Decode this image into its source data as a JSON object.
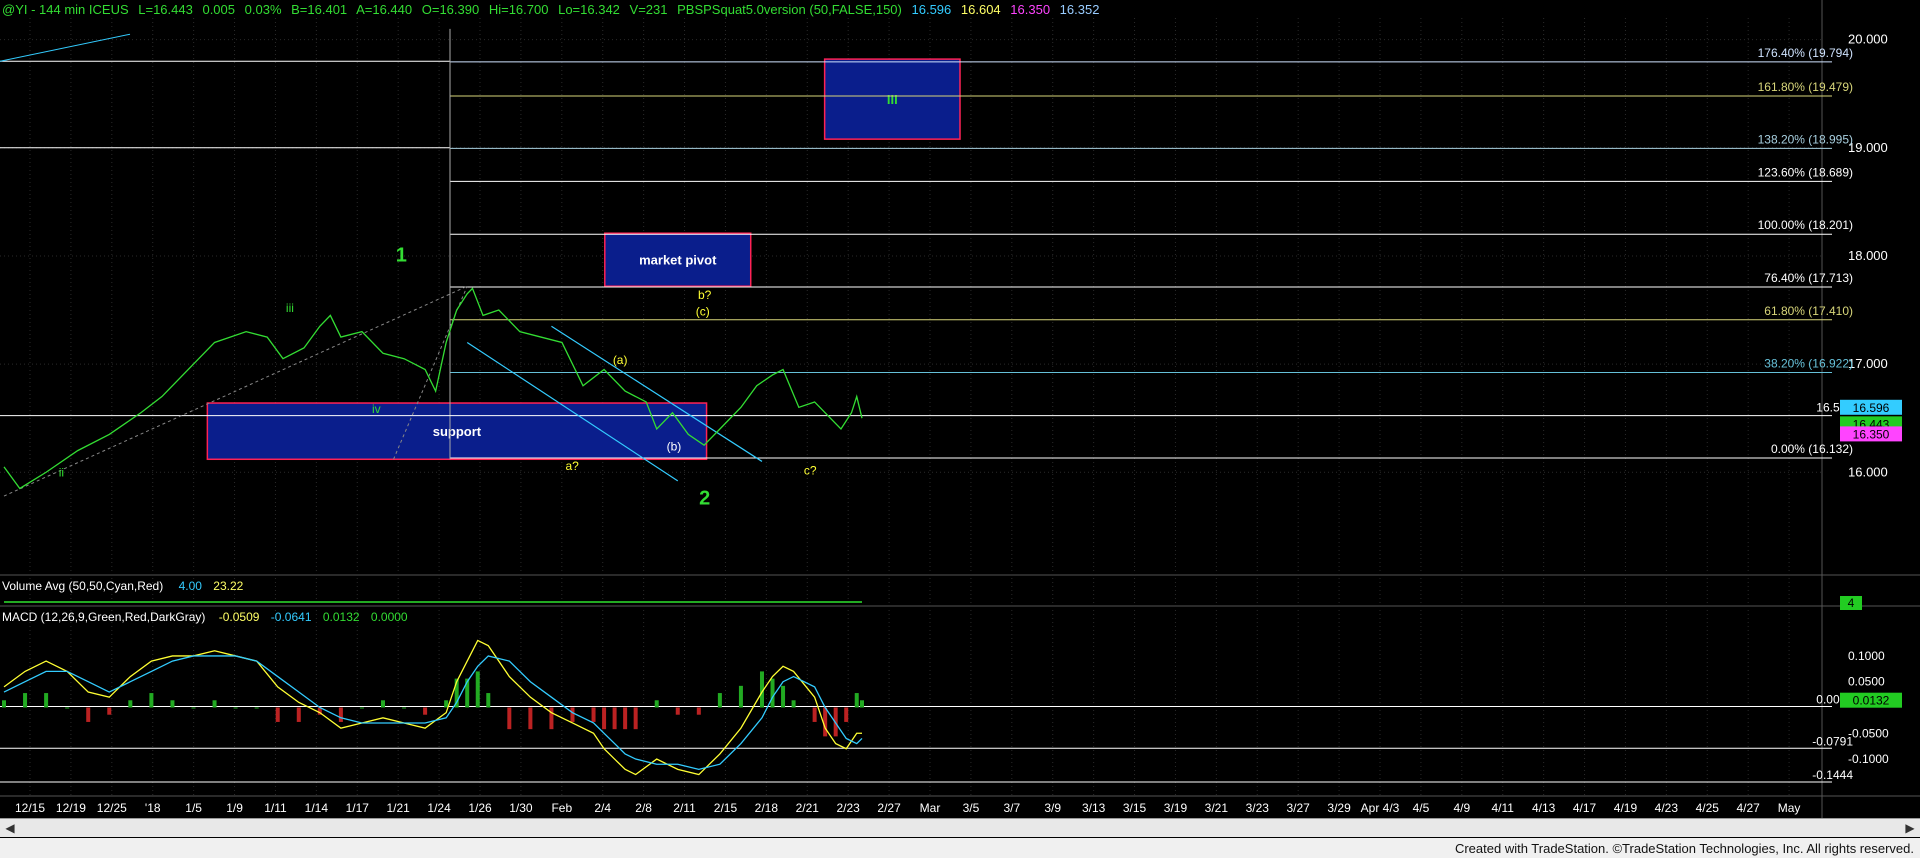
{
  "header": {
    "symbol": "@YI - 144 min  ICEUS",
    "last": "L=16.443",
    "chg": "0.005",
    "pct": "0.03%",
    "bid": "B=16.401",
    "ask": "A=16.440",
    "open": "O=16.390",
    "hi": "Hi=16.700",
    "lo": "Lo=16.342",
    "vol": "V=231",
    "study": "PBSPSquat5.0version (50,FALSE,150)",
    "study_vals": [
      "16.596",
      "16.604",
      "16.350",
      "16.352"
    ],
    "study_colors": [
      "#33ccff",
      "#ffff66",
      "#ff44ff",
      "#99ccff"
    ]
  },
  "volume_header": {
    "label": "Volume Avg (50,50,Cyan,Red)",
    "v1": "4.00",
    "v2": "23.22"
  },
  "macd_header": {
    "label": "MACD (12,26,9,Green,Red,DarkGray)",
    "v1": "-0.0509",
    "v2": "-0.0641",
    "v3": "0.0132",
    "v4": "0.0000"
  },
  "footer": "Created with TradeStation. ©TradeStation Technologies, Inc. All rights reserved.",
  "chart_data": {
    "type": "line",
    "price_axis": {
      "ticks": [
        "20.000",
        "19.000",
        "18.000",
        "17.000",
        "16.000"
      ],
      "ylim": [
        15.05,
        20.2
      ]
    },
    "x_tick_labels": [
      "12/15",
      "12/19",
      "12/25",
      "'18",
      "1/5",
      "1/9",
      "1/11",
      "1/14",
      "1/17",
      "1/21",
      "1/24",
      "1/26",
      "1/30",
      "Feb",
      "2/4",
      "2/8",
      "2/11",
      "2/15",
      "2/18",
      "2/21",
      "2/23",
      "2/27",
      "Mar",
      "3/5",
      "3/7",
      "3/9",
      "3/13",
      "3/15",
      "3/19",
      "3/21",
      "3/23",
      "3/27",
      "3/29",
      "Apr 4/3",
      "4/5",
      "4/9",
      "4/11",
      "4/13",
      "4/17",
      "4/19",
      "4/23",
      "4/25",
      "4/27",
      "May"
    ],
    "price_series": [
      [
        0,
        16.05
      ],
      [
        3,
        15.85
      ],
      [
        8,
        16.0
      ],
      [
        14,
        16.2
      ],
      [
        20,
        16.35
      ],
      [
        26,
        16.55
      ],
      [
        30,
        16.7
      ],
      [
        36,
        17.0
      ],
      [
        40,
        17.2
      ],
      [
        46,
        17.3
      ],
      [
        50,
        17.25
      ],
      [
        53,
        17.05
      ],
      [
        57,
        17.15
      ],
      [
        60,
        17.35
      ],
      [
        62,
        17.45
      ],
      [
        64,
        17.25
      ],
      [
        68,
        17.3
      ],
      [
        72,
        17.1
      ],
      [
        76,
        17.05
      ],
      [
        78,
        17.0
      ],
      [
        80,
        16.95
      ],
      [
        82,
        16.75
      ],
      [
        84,
        17.2
      ],
      [
        86,
        17.5
      ],
      [
        88,
        17.65
      ],
      [
        89,
        17.7
      ],
      [
        91,
        17.45
      ],
      [
        94,
        17.5
      ],
      [
        98,
        17.3
      ],
      [
        102,
        17.25
      ],
      [
        106,
        17.2
      ],
      [
        110,
        16.8
      ],
      [
        114,
        16.95
      ],
      [
        118,
        16.75
      ],
      [
        122,
        16.65
      ],
      [
        124,
        16.4
      ],
      [
        127,
        16.55
      ],
      [
        130,
        16.35
      ],
      [
        133,
        16.25
      ],
      [
        136,
        16.4
      ],
      [
        140,
        16.6
      ],
      [
        143,
        16.8
      ],
      [
        146,
        16.9
      ],
      [
        148,
        16.95
      ],
      [
        151,
        16.6
      ],
      [
        154,
        16.65
      ],
      [
        157,
        16.5
      ],
      [
        159,
        16.4
      ],
      [
        161,
        16.55
      ],
      [
        162,
        16.7
      ],
      [
        163,
        16.5
      ]
    ],
    "fib_levels": [
      {
        "pct": "176.40% (19.794)",
        "price": 19.794,
        "color": "#cfe3ff",
        "extra": "19.715"
      },
      {
        "pct": "161.80% (19.479)",
        "price": 19.479,
        "color": "#d8d67a"
      },
      {
        "pct": "138.20% (18.995)",
        "price": 18.995,
        "color": "#a8d0e0",
        "extra": "18.995"
      },
      {
        "pct": "123.60% (18.689)",
        "price": 18.689,
        "color": "#ffffff"
      },
      {
        "pct": "100.00% (18.201)",
        "price": 18.201,
        "color": "#ffffff"
      },
      {
        "pct": "76.40% (17.713)",
        "price": 17.713,
        "color": "#ffffff"
      },
      {
        "pct": "61.80% (17.410)",
        "price": 17.41,
        "color": "#d8d67a"
      },
      {
        "pct": "38.20% (16.922)",
        "price": 16.922,
        "color": "#66c0d8"
      },
      {
        "pct": "0.00% (16.132)",
        "price": 16.132,
        "color": "#ffffff"
      }
    ],
    "price_tags": [
      {
        "text": "16.596",
        "price": 16.596,
        "bg": "#33ccff",
        "fg": "#000"
      },
      {
        "text": "16.443",
        "price": 16.443,
        "bg": "#22cc22",
        "fg": "#000"
      },
      {
        "text": "16.350",
        "price": 16.35,
        "bg": "#ff44ff",
        "fg": "#000"
      }
    ],
    "level_16524": {
      "text": "16.524",
      "price": 16.524
    },
    "boxes": [
      {
        "label": "III",
        "label_color": "#33dd33",
        "bold": true,
        "p_top": 19.82,
        "p_bot": 19.08,
        "x0": 0.4295,
        "x1": 0.5
      },
      {
        "label": "market pivot",
        "label_color": "#ffffff",
        "bold": true,
        "p_top": 18.21,
        "p_bot": 17.72,
        "x0": 0.315,
        "x1": 0.391
      },
      {
        "label": "support",
        "label_color": "#ffffff",
        "bold": true,
        "p_top": 16.64,
        "p_bot": 16.12,
        "x0": 0.108,
        "x1": 0.368
      }
    ],
    "wave_labels": [
      {
        "text": "1",
        "color": "#33dd33",
        "big": true,
        "x": 0.209,
        "price": 17.95
      },
      {
        "text": "iii",
        "color": "#33dd33",
        "x": 0.151,
        "price": 17.48
      },
      {
        "text": "iv",
        "color": "#33dd33",
        "x": 0.196,
        "price": 16.55
      },
      {
        "text": "ii",
        "color": "#33dd33",
        "x": 0.032,
        "price": 15.96
      },
      {
        "text": "2",
        "color": "#33dd33",
        "big": true,
        "x": 0.367,
        "price": 15.7
      },
      {
        "text": "b?",
        "color": "#ffff33",
        "x": 0.367,
        "price": 17.6
      },
      {
        "text": "(c)",
        "color": "#ffff33",
        "x": 0.366,
        "price": 17.45
      },
      {
        "text": "(a)",
        "color": "#ffff33",
        "x": 0.323,
        "price": 17.0
      },
      {
        "text": "(b)",
        "color": "#ffffff",
        "x": 0.351,
        "price": 16.2
      },
      {
        "text": "a?",
        "color": "#ffff33",
        "x": 0.298,
        "price": 16.02
      },
      {
        "text": "c?",
        "color": "#ffff33",
        "x": 0.422,
        "price": 15.98
      }
    ],
    "macd_axis": {
      "ticks": [
        "0.1000",
        "0.0500",
        "-0.0500",
        "-0.1000"
      ],
      "ylim": [
        -0.16,
        0.16
      ]
    },
    "macd_levels": [
      {
        "text": "0.0019",
        "value": 0.0019,
        "color": "#ffffff"
      },
      {
        "text": "-0.0791",
        "value": -0.0791,
        "color": "#ffffff"
      },
      {
        "text": "-0.1444",
        "value": -0.1444,
        "color": "#ffffff"
      }
    ],
    "macd_tag": {
      "text": "0.0132",
      "value": 0.0132,
      "bg": "#22cc22",
      "fg": "#000"
    },
    "macd_line": [
      [
        0,
        0.04
      ],
      [
        4,
        0.07
      ],
      [
        8,
        0.09
      ],
      [
        12,
        0.07
      ],
      [
        16,
        0.03
      ],
      [
        20,
        0.02
      ],
      [
        24,
        0.06
      ],
      [
        28,
        0.09
      ],
      [
        32,
        0.1
      ],
      [
        36,
        0.1
      ],
      [
        40,
        0.11
      ],
      [
        44,
        0.1
      ],
      [
        48,
        0.09
      ],
      [
        52,
        0.04
      ],
      [
        56,
        0.01
      ],
      [
        60,
        -0.01
      ],
      [
        64,
        -0.04
      ],
      [
        68,
        -0.03
      ],
      [
        72,
        -0.02
      ],
      [
        76,
        -0.03
      ],
      [
        80,
        -0.04
      ],
      [
        84,
        -0.01
      ],
      [
        86,
        0.05
      ],
      [
        88,
        0.09
      ],
      [
        90,
        0.13
      ],
      [
        92,
        0.12
      ],
      [
        96,
        0.06
      ],
      [
        100,
        0.02
      ],
      [
        104,
        -0.01
      ],
      [
        108,
        -0.03
      ],
      [
        112,
        -0.05
      ],
      [
        114,
        -0.08
      ],
      [
        116,
        -0.1
      ],
      [
        118,
        -0.12
      ],
      [
        120,
        -0.13
      ],
      [
        124,
        -0.1
      ],
      [
        128,
        -0.12
      ],
      [
        132,
        -0.13
      ],
      [
        136,
        -0.09
      ],
      [
        140,
        -0.04
      ],
      [
        144,
        0.03
      ],
      [
        146,
        0.06
      ],
      [
        148,
        0.08
      ],
      [
        150,
        0.07
      ],
      [
        154,
        0.02
      ],
      [
        156,
        -0.04
      ],
      [
        158,
        -0.07
      ],
      [
        160,
        -0.08
      ],
      [
        162,
        -0.05
      ],
      [
        163,
        -0.05
      ]
    ],
    "signal_line": [
      [
        0,
        0.03
      ],
      [
        4,
        0.05
      ],
      [
        8,
        0.07
      ],
      [
        12,
        0.07
      ],
      [
        16,
        0.05
      ],
      [
        20,
        0.03
      ],
      [
        24,
        0.05
      ],
      [
        28,
        0.07
      ],
      [
        32,
        0.09
      ],
      [
        36,
        0.1
      ],
      [
        40,
        0.1
      ],
      [
        44,
        0.1
      ],
      [
        48,
        0.09
      ],
      [
        52,
        0.06
      ],
      [
        56,
        0.03
      ],
      [
        60,
        0.0
      ],
      [
        64,
        -0.02
      ],
      [
        68,
        -0.03
      ],
      [
        72,
        -0.03
      ],
      [
        76,
        -0.03
      ],
      [
        80,
        -0.03
      ],
      [
        84,
        -0.02
      ],
      [
        86,
        0.01
      ],
      [
        88,
        0.05
      ],
      [
        90,
        0.08
      ],
      [
        92,
        0.1
      ],
      [
        96,
        0.09
      ],
      [
        100,
        0.05
      ],
      [
        104,
        0.02
      ],
      [
        108,
        -0.01
      ],
      [
        112,
        -0.03
      ],
      [
        114,
        -0.05
      ],
      [
        116,
        -0.07
      ],
      [
        118,
        -0.09
      ],
      [
        120,
        -0.1
      ],
      [
        124,
        -0.11
      ],
      [
        128,
        -0.11
      ],
      [
        132,
        -0.12
      ],
      [
        136,
        -0.11
      ],
      [
        140,
        -0.07
      ],
      [
        144,
        -0.02
      ],
      [
        146,
        0.02
      ],
      [
        148,
        0.05
      ],
      [
        150,
        0.06
      ],
      [
        154,
        0.04
      ],
      [
        156,
        0.0
      ],
      [
        158,
        -0.03
      ],
      [
        160,
        -0.06
      ],
      [
        162,
        -0.07
      ],
      [
        163,
        -0.06
      ]
    ],
    "volume_axis": {
      "tag": "4"
    }
  }
}
